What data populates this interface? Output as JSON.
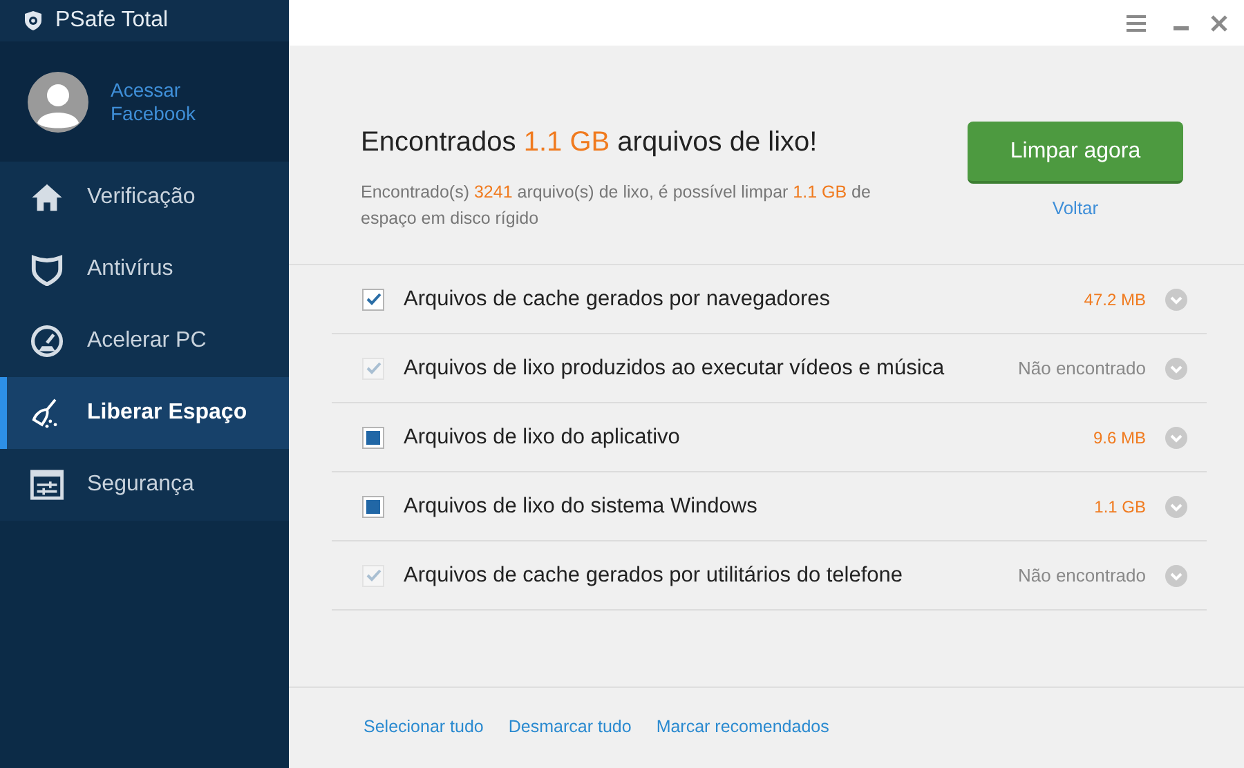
{
  "app": {
    "title": "PSafe Total"
  },
  "profile": {
    "link_line1": "Acessar",
    "link_line2": "Facebook"
  },
  "nav": [
    {
      "kind": "home",
      "label": "Verificação",
      "selected": false
    },
    {
      "kind": "shield",
      "label": "Antivírus",
      "selected": false
    },
    {
      "kind": "gauge",
      "label": "Acelerar PC",
      "selected": false
    },
    {
      "kind": "broom",
      "label": "Liberar Espaço",
      "selected": true
    },
    {
      "kind": "sliders",
      "label": "Segurança",
      "selected": false
    }
  ],
  "summary": {
    "headline": [
      {
        "text": "Encontrados ",
        "highlight": false
      },
      {
        "text": "1.1 GB",
        "highlight": true
      },
      {
        "text": " arquivos de lixo!",
        "highlight": false
      }
    ],
    "description": [
      {
        "text": "Encontrado(s) ",
        "highlight": false
      },
      {
        "text": "3241",
        "highlight": true
      },
      {
        "text": " arquivo(s) de lixo, é possível limpar  ",
        "highlight": false
      },
      {
        "text": "1.1 GB",
        "highlight": true
      },
      {
        "text": " de espaço em disco rígido",
        "highlight": false
      }
    ],
    "primary_button": "Limpar agora",
    "back_link": "Voltar"
  },
  "items": [
    {
      "label": "Arquivos de cache gerados por navegadores",
      "checked": true,
      "partial": false,
      "disabled": false,
      "result": "47.2 MB",
      "found": true
    },
    {
      "label": "Arquivos de lixo produzidos ao executar vídeos e música",
      "checked": true,
      "partial": false,
      "disabled": true,
      "result": "Não encontrado",
      "found": false
    },
    {
      "label": "Arquivos de lixo do aplicativo",
      "checked": true,
      "partial": true,
      "disabled": false,
      "result": "9.6 MB",
      "found": true
    },
    {
      "label": "Arquivos de lixo do sistema Windows",
      "checked": true,
      "partial": true,
      "disabled": false,
      "result": "1.1 GB",
      "found": true
    },
    {
      "label": "Arquivos de cache gerados por utilitários do telefone",
      "checked": true,
      "partial": false,
      "disabled": true,
      "result": "Não encontrado",
      "found": false
    }
  ],
  "footer_links": [
    "Selecionar tudo",
    "Desmarcar tudo",
    "Marcar recomendados"
  ]
}
